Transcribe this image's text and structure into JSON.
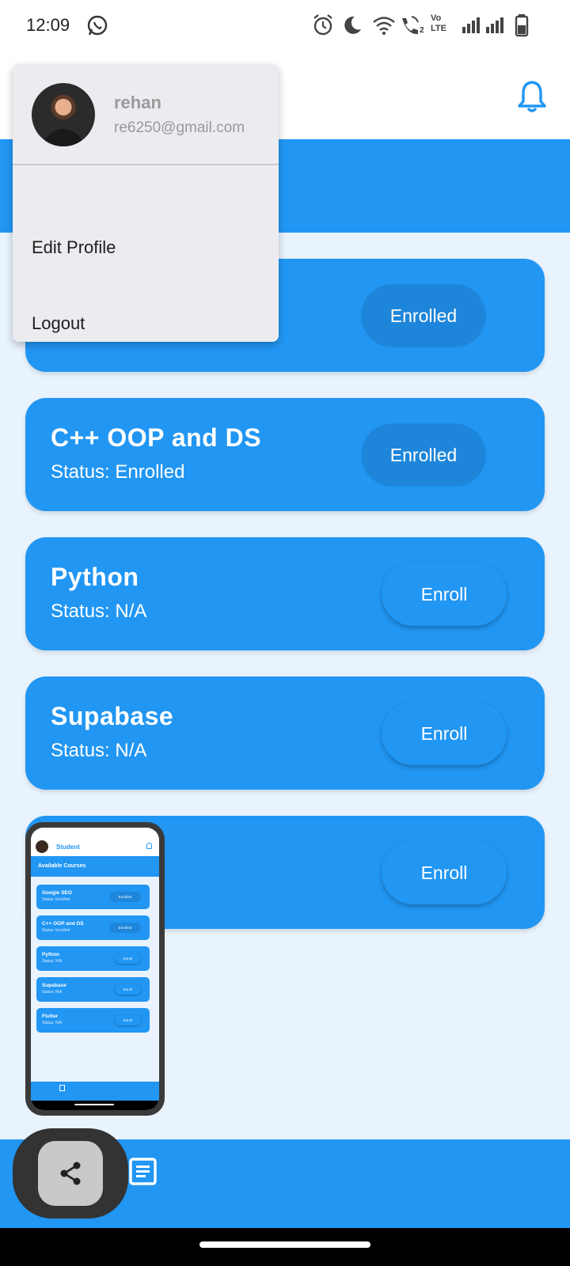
{
  "status_bar": {
    "time": "12:09",
    "icons": [
      "whatsapp-icon",
      "alarm-icon",
      "do-not-disturb-moon-icon",
      "wifi-icon",
      "wifi-calling-icon",
      "volte-icon",
      "signal-icon",
      "signal-icon",
      "battery-icon"
    ],
    "volte_label": "Vo LTE",
    "sim_badge": "2"
  },
  "app_bar": {
    "notification_icon": "bell-icon",
    "accent_color": "#2196f3"
  },
  "profile_menu": {
    "name": "rehan",
    "email": "re6250@gmail.com",
    "items": [
      {
        "label": "Edit Profile"
      },
      {
        "label": "Logout"
      }
    ]
  },
  "courses": [
    {
      "title": "",
      "status": "",
      "button": "Enrolled"
    },
    {
      "title": "C++ OOP and DS",
      "status": "Status: Enrolled",
      "button": "Enrolled"
    },
    {
      "title": "Python",
      "status": "Status: N/A",
      "button": "Enroll"
    },
    {
      "title": "Supabase",
      "status": "Status: N/A",
      "button": "Enroll"
    },
    {
      "title": "",
      "status": "",
      "button": "Enroll"
    }
  ],
  "preview": {
    "app_title": "Student",
    "section_title": "Available Courses",
    "cards": [
      {
        "title": "Google SEO",
        "status": "Status: Enrolled",
        "button": "Enrolled"
      },
      {
        "title": "C++ OOP and DS",
        "status": "Status: Enrolled",
        "button": "Enrolled"
      },
      {
        "title": "Python",
        "status": "Status: N/A",
        "button": "Enroll"
      },
      {
        "title": "Supabase",
        "status": "Status: N/A",
        "button": "Enroll"
      },
      {
        "title": "Flutter",
        "status": "Status: N/A",
        "button": "Enroll"
      }
    ]
  },
  "bottom_nav": {
    "icons": [
      "list-icon"
    ],
    "share_icon": "share-icon"
  }
}
